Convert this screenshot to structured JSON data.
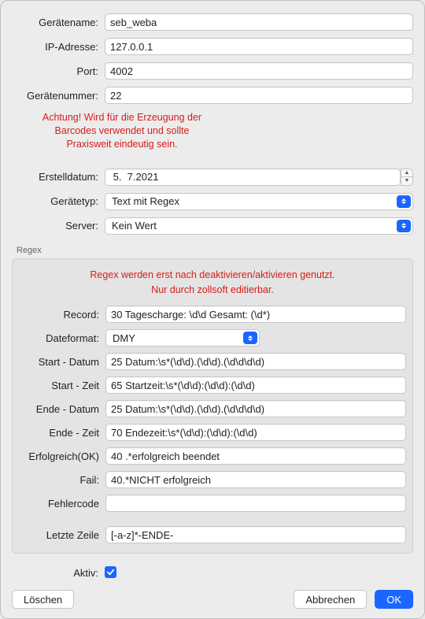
{
  "labels": {
    "geraetename": "Gerätename:",
    "ip": "IP-Adresse:",
    "port": "Port:",
    "geraetenummer": "Gerätenummer:",
    "erstelldatum": "Erstelldatum:",
    "geraetetyp": "Gerätetyp:",
    "server": "Server:",
    "record": "Record:",
    "dateformat": "Dateformat:",
    "start_datum": "Start - Datum",
    "start_zeit": "Start - Zeit",
    "ende_datum": "Ende - Datum",
    "ende_zeit": "Ende - Zeit",
    "erfolgreich": "Erfolgreich(OK)",
    "fail": "Fail:",
    "fehlercode": "Fehlercode",
    "letzte_zeile": "Letzte Zeile",
    "aktiv": "Aktiv:"
  },
  "fields": {
    "geraetename": "seb_weba",
    "ip": "127.0.0.1",
    "port": "4002",
    "geraetenummer": "22",
    "erstelldatum": " 5.  7.2021",
    "geraetetyp": "Text mit Regex",
    "server": "Kein Wert",
    "record": "30 Tagescharge: \\d\\d Gesamt: (\\d*)",
    "dateformat": "DMY",
    "start_datum": "25 Datum:\\s*(\\d\\d).(\\d\\d).(\\d\\d\\d\\d)",
    "start_zeit": "65 Startzeit:\\s*(\\d\\d):(\\d\\d):(\\d\\d)",
    "ende_datum": "25 Datum:\\s*(\\d\\d).(\\d\\d).(\\d\\d\\d\\d)",
    "ende_zeit": "70 Endezeit:\\s*(\\d\\d):(\\d\\d):(\\d\\d)",
    "erfolgreich": "40 .*erfolgreich beendet",
    "fail": "40.*NICHT erfolgreich",
    "fehlercode": "",
    "letzte_zeile": "[-a-z]*-ENDE-",
    "aktiv": true
  },
  "warnings": {
    "top1": "Achtung! Wird für die Erzeugung der",
    "top2": "Barcodes verwendet und sollte",
    "top3": "Praxisweit eindeutig sein.",
    "regex1": "Regex werden erst nach deaktivieren/aktivieren  genutzt.",
    "regex2": "Nur durch zollsoft editierbar."
  },
  "section": {
    "regex": "Regex"
  },
  "buttons": {
    "loeschen": "Löschen",
    "abbrechen": "Abbrechen",
    "ok": "OK"
  }
}
